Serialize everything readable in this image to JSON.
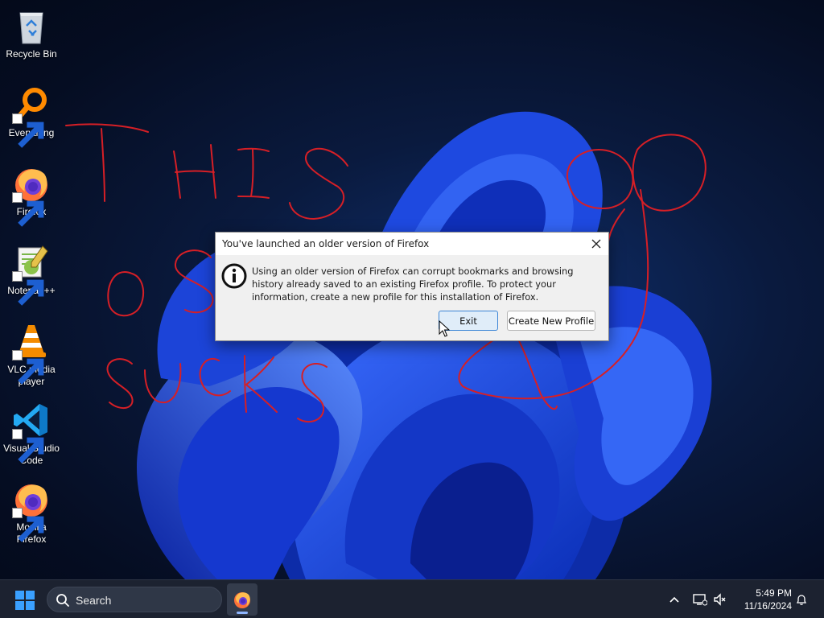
{
  "desktop": {
    "icons": [
      {
        "label": "Recycle Bin",
        "icon": "recycle-bin-icon"
      },
      {
        "label": "Everything",
        "icon": "everything-search-icon"
      },
      {
        "label": "Firefox",
        "icon": "firefox-icon"
      },
      {
        "label": "Notepad++",
        "icon": "notepad-plus-plus-icon"
      },
      {
        "label": "VLC media player",
        "icon": "vlc-icon"
      },
      {
        "label": "Visual Studio Code",
        "icon": "vscode-icon"
      },
      {
        "label": "Mozilla Firefox",
        "icon": "firefox-icon"
      }
    ]
  },
  "dialog": {
    "title": "You've launched an older version of Firefox",
    "message": "Using an older version of Firefox can corrupt bookmarks and browsing history already saved to an existing Firefox profile. To protect your information, create a new profile for this installation of Firefox.",
    "exit_label": "Exit",
    "create_profile_label": "Create New Profile"
  },
  "taskbar": {
    "search_placeholder": "Search",
    "time": "5:49 PM",
    "date": "11/16/2024"
  },
  "colors": {
    "scribble": "#d61f26",
    "accent": "#3c86d6",
    "taskbar": "#1c2230"
  }
}
